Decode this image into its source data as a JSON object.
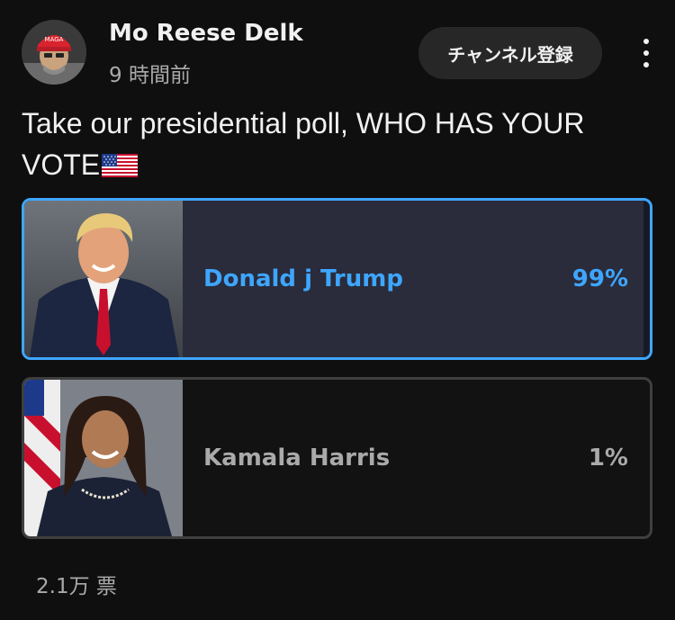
{
  "post": {
    "channel_name": "Mo Reese Delk",
    "timestamp": "9 時間前",
    "subscribe_label": "チャンネル登録",
    "text": "Take our presidential poll, WHO HAS YOUR VOTE",
    "text_emoji": "us-flag-icon"
  },
  "poll": {
    "options": [
      {
        "label": "Donald j Trump",
        "percent_label": "99%",
        "percent": 99,
        "selected": true,
        "accent": "#3ea6ff"
      },
      {
        "label": "Kamala Harris",
        "percent_label": "1%",
        "percent": 1,
        "selected": false,
        "accent": "#aaaaaa"
      }
    ],
    "vote_count": "2.1万 票"
  },
  "colors": {
    "background": "#0f0f0f",
    "selected_border": "#3ea6ff",
    "secondary_text": "#aaaaaa",
    "button_bg": "#272727"
  }
}
